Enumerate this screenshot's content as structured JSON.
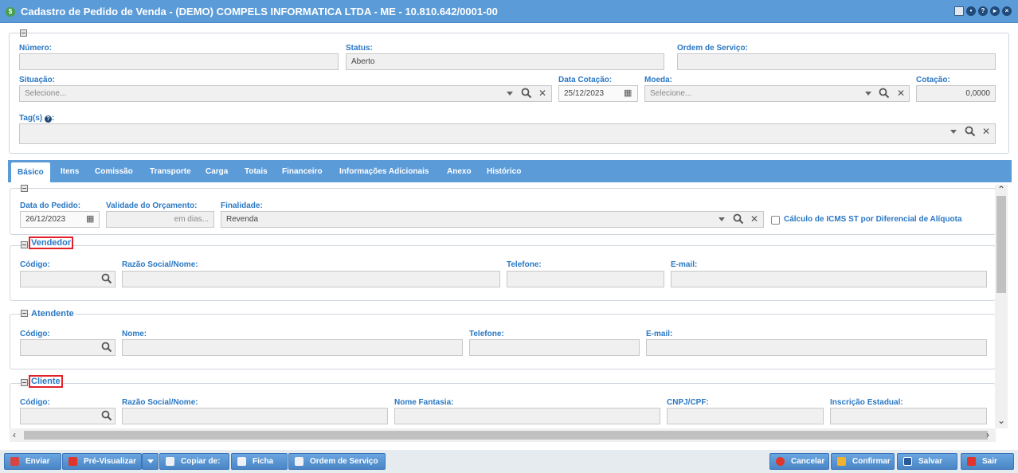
{
  "window": {
    "title": "Cadastro de Pedido de Venda - (DEMO) COMPELS INFORMATICA LTDA - ME - 10.810.642/0001-00"
  },
  "header": {
    "numero_label": "Número:",
    "numero_value": "",
    "status_label": "Status:",
    "status_value": "Aberto",
    "os_label": "Ordem de Serviço:",
    "os_value": "",
    "situacao_label": "Situação:",
    "situacao_placeholder": "Selecione...",
    "data_cotacao_label": "Data Cotação:",
    "data_cotacao_value": "25/12/2023",
    "moeda_label": "Moeda:",
    "moeda_placeholder": "Selecione...",
    "cotacao_label": "Cotação:",
    "cotacao_value": "0,0000",
    "tags_label": "Tag(s)"
  },
  "tabs": [
    "Básico",
    "Itens",
    "Comissão",
    "Transporte",
    "Carga",
    "Totais",
    "Financeiro",
    "Informações Adicionais",
    "Anexo",
    "Histórico"
  ],
  "basico": {
    "data_pedido_label": "Data do Pedido:",
    "data_pedido_value": "26/12/2023",
    "validade_label": "Validade do Orçamento:",
    "validade_placeholder": "em dias...",
    "finalidade_label": "Finalidade:",
    "finalidade_value": "Revenda",
    "icms_label": "Cálculo de ICMS ST por Diferencial de Alíquota"
  },
  "vendedor": {
    "title": "Vendedor",
    "codigo_label": "Código:",
    "razao_label": "Razão Social/Nome:",
    "telefone_label": "Telefone:",
    "email_label": "E-mail:"
  },
  "atendente": {
    "title": "Atendente",
    "codigo_label": "Código:",
    "nome_label": "Nome:",
    "telefone_label": "Telefone:",
    "email_label": "E-mail:"
  },
  "cliente": {
    "title": "Cliente",
    "codigo_label": "Código:",
    "razao_label": "Razão Social/Nome:",
    "fantasia_label": "Nome Fantasia:",
    "cnpj_label": "CNPJ/CPF:",
    "ie_label": "Inscrição Estadual:"
  },
  "footer": {
    "enviar": "Enviar",
    "previsualizar": "Pré-Visualizar",
    "copiar": "Copiar de:",
    "ficha": "Ficha",
    "os": "Ordem de Serviço",
    "cancelar": "Cancelar",
    "confirmar": "Confirmar",
    "salvar": "Salvar",
    "sair": "Sair"
  },
  "colors": {
    "accent": "#5b9bd8",
    "label": "#2a78c4",
    "highlight": "#e2222a"
  }
}
